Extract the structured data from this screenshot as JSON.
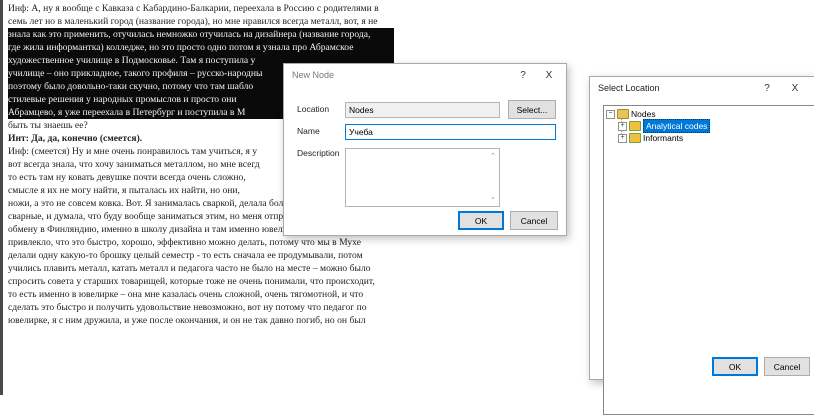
{
  "document": {
    "lines": [
      {
        "text": "Инф: А, ну я вообще с Кавказа с Кабардино-Балкарии, переехала в Россию с родителями в",
        "style": "normal"
      },
      {
        "text": "семь лет но в маленький город (название города), но мне нравился всегда металл, вот, я не",
        "style": "normal"
      },
      {
        "text": "знала как это применить, отучилась немножко отучилась на дизайнера (название города,",
        "style": "selected"
      },
      {
        "text": "где жила информантка) колледже, но это просто одно потом я узнала про Абрамское",
        "style": "selected"
      },
      {
        "text": "художественное училище в Подмосковье. Там я поступила у",
        "style": "selected"
      },
      {
        "text": "училище – оно прикладное, такого профиля – русско-народны",
        "style": "selected"
      },
      {
        "text": "поэтому было довольно-таки скучно, потому что там шабло",
        "style": "selected"
      },
      {
        "text": "стилевые решения у народных промыслов и просто они",
        "style": "selected"
      },
      {
        "text": "Абрамцево, я уже переехала в Петербург и поступила в М",
        "style": "selected"
      },
      {
        "text": "быть ты знаешь ее?",
        "style": "normal"
      },
      {
        "text": "Инт: Да, да, конечно (смеется).",
        "style": "bold"
      },
      {
        "text": "Инф: (смеется) Ну и мне очень понравилось там учиться, я у",
        "style": "normal"
      },
      {
        "text": "вот всегда знала, что хочу заниматься металлом, но мне всегд",
        "style": "normal"
      },
      {
        "text": "то есть там ну ковать девушке почти всегда очень сложно,",
        "style": "normal"
      },
      {
        "text": "смысле я их не могу найти, я пыталась их найти, но они,",
        "style": "normal"
      },
      {
        "text": "ножи, а это не совсем ковка. Вот. Я занималась сваркой, делала большие фактуры",
        "style": "normal"
      },
      {
        "text": "сварные, и думала, что буду вообще заниматься этим, но меня отправили, слава богу, по",
        "style": "normal"
      },
      {
        "text": "обмену в Финляндию, именно в школу дизайна и там именно ювелирное искусство меня",
        "style": "normal"
      },
      {
        "text": "привлекло, что это быстро, хорошо, эффективно можно делать, потому что мы в Мухе",
        "style": "normal"
      },
      {
        "text": "делали одну какую-то брошку целый семестр - то есть сначала ее продумывали, потом",
        "style": "normal"
      },
      {
        "text": "учились плавить металл, катать металл и педагога часто не было на месте – можно было",
        "style": "normal"
      },
      {
        "text": "спросить совета у старших товарищей, которые тоже не очень понимали, что происходит,",
        "style": "normal"
      },
      {
        "text": "то есть именно в ювелирке – она мне казалась очень сложной, очень тягомотной, и что",
        "style": "normal"
      },
      {
        "text": "сделать это быстро и получить удовольствие невозможно, вот ну потому что педагог по",
        "style": "normal"
      },
      {
        "text": "ювелирке, я с ним дружила, и уже после окончания, и он не так давно погиб, но он был",
        "style": "normal"
      }
    ]
  },
  "new_node_dialog": {
    "title": "New Node",
    "help": "?",
    "close": "X",
    "location_label": "Location",
    "location_value": "Nodes",
    "select_button": "Select...",
    "name_label": "Name",
    "name_value": "Учеба",
    "description_label": "Description",
    "description_value": "",
    "ok_button": "OK",
    "cancel_button": "Cancel"
  },
  "select_location_dialog": {
    "title": "Select Location",
    "help": "?",
    "close": "X",
    "tree": {
      "root": {
        "label": "Nodes",
        "expander": "−"
      },
      "children": [
        {
          "label": "Analytical codes",
          "selected": true,
          "expander": "+"
        },
        {
          "label": "Informants",
          "selected": false,
          "expander": "+"
        }
      ]
    },
    "ok_button": "OK",
    "cancel_button": "Cancel"
  },
  "colors": {
    "selection_bg": "#0a0a0a",
    "tree_selection": "#0078d7",
    "default_button_border": "#0078d7",
    "folder": "#e8c25a"
  }
}
